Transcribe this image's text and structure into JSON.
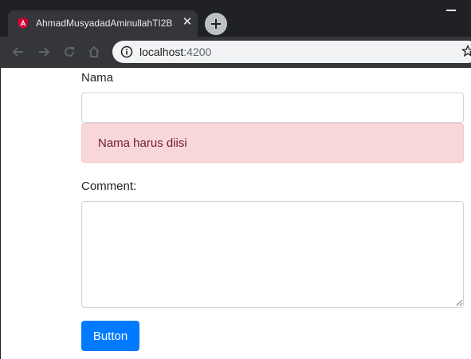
{
  "browser": {
    "tab_title": "AhmadMusyadadAminullahTI2B",
    "tab_close_glyph": "✕",
    "favicon": "angular-icon",
    "url_host": "localhost",
    "url_port": ":4200",
    "colors": {
      "titlebar": "#202124",
      "toolbar": "#35363a",
      "omnibox": "#f1f3f4"
    }
  },
  "form": {
    "nama_label": "Nama",
    "nama_value": "",
    "nama_error": "Nama harus diisi",
    "comment_label": "Comment:",
    "comment_value": "",
    "submit_label": "Button",
    "colors": {
      "primary": "#007bff",
      "danger_bg": "#f8d7da",
      "danger_text": "#721c24"
    }
  }
}
